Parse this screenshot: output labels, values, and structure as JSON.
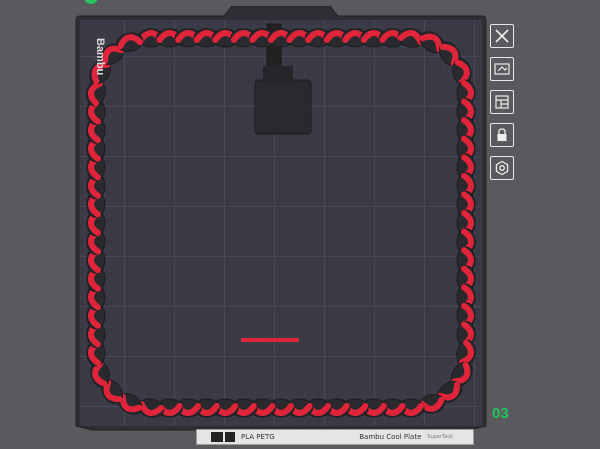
{
  "plate": {
    "number": "03",
    "brand_text": "Bambu",
    "filament_label": "PLA PETG",
    "plate_name": "Bambu Cool Plate",
    "plate_subtype": "SuperTack"
  },
  "toolbar": {
    "items": [
      {
        "name": "close-plate",
        "icon": "close-icon"
      },
      {
        "name": "auto-orient",
        "icon": "orient-icon"
      },
      {
        "name": "arrange",
        "icon": "arrange-icon"
      },
      {
        "name": "lock-plate",
        "icon": "lock-icon"
      },
      {
        "name": "plate-settings",
        "icon": "gear-icon"
      }
    ]
  },
  "colors": {
    "background": "#5a5a5e",
    "bed": "#3b3b47",
    "grid": "#4a4a58",
    "chain_red": "#e0243a",
    "chain_dark": "#2a2a2e",
    "plate_number": "#22c55e"
  }
}
